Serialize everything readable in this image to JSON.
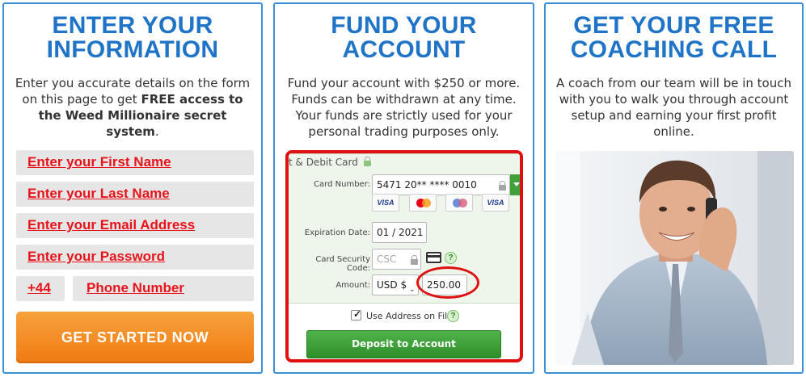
{
  "panel1": {
    "title_line1": "ENTER YOUR",
    "title_line2": "INFORMATION",
    "desc_part1": "Enter you accurate details on the form on this page to get ",
    "desc_bold": "FREE access to the Weed Millionaire secret system",
    "desc_part2": ".",
    "fields": {
      "first_name": "Enter your First Name",
      "last_name": "Enter your Last Name",
      "email": "Enter your Email Address",
      "password": "Enter your Password",
      "phone_code": "+44",
      "phone": "Phone Number"
    },
    "cta_label": "GET STARTED NOW"
  },
  "panel2": {
    "title_line1": "FUND YOUR",
    "title_line2": "ACCOUNT",
    "desc": "Fund your account with $250 or more. Funds can be withdrawn at any time. Your funds are strictly used for your personal trading purposes only.",
    "widget": {
      "header": "t & Debit Card",
      "card_number_label": "Card Number:",
      "card_number_value": "5471 20** **** 0010",
      "card_brands": [
        "VISA",
        "mastercard",
        "maestro",
        "VISA"
      ],
      "expiration_label": "Expiration Date:",
      "expiration_value": "01 / 2021",
      "csc_label": "Card Security Code:",
      "csc_placeholder": "CSC",
      "amount_label": "Amount:",
      "currency_value": "USD $",
      "amount_value": "250.00",
      "use_address_label": "Use Address on File",
      "use_address_checked": true,
      "deposit_label": "Deposit to Account"
    }
  },
  "panel3": {
    "title_line1": "GET YOUR FREE",
    "title_line2": "COACHING CALL",
    "desc": "A coach from our team will be in touch with you to walk you through account setup and earning your first profit online."
  },
  "colors": {
    "accent_blue": "#1f74c7",
    "field_text_red": "#e8141b",
    "cta_orange": "#f28a1f",
    "deposit_green": "#3ea13a",
    "highlight_red": "#e01010"
  }
}
